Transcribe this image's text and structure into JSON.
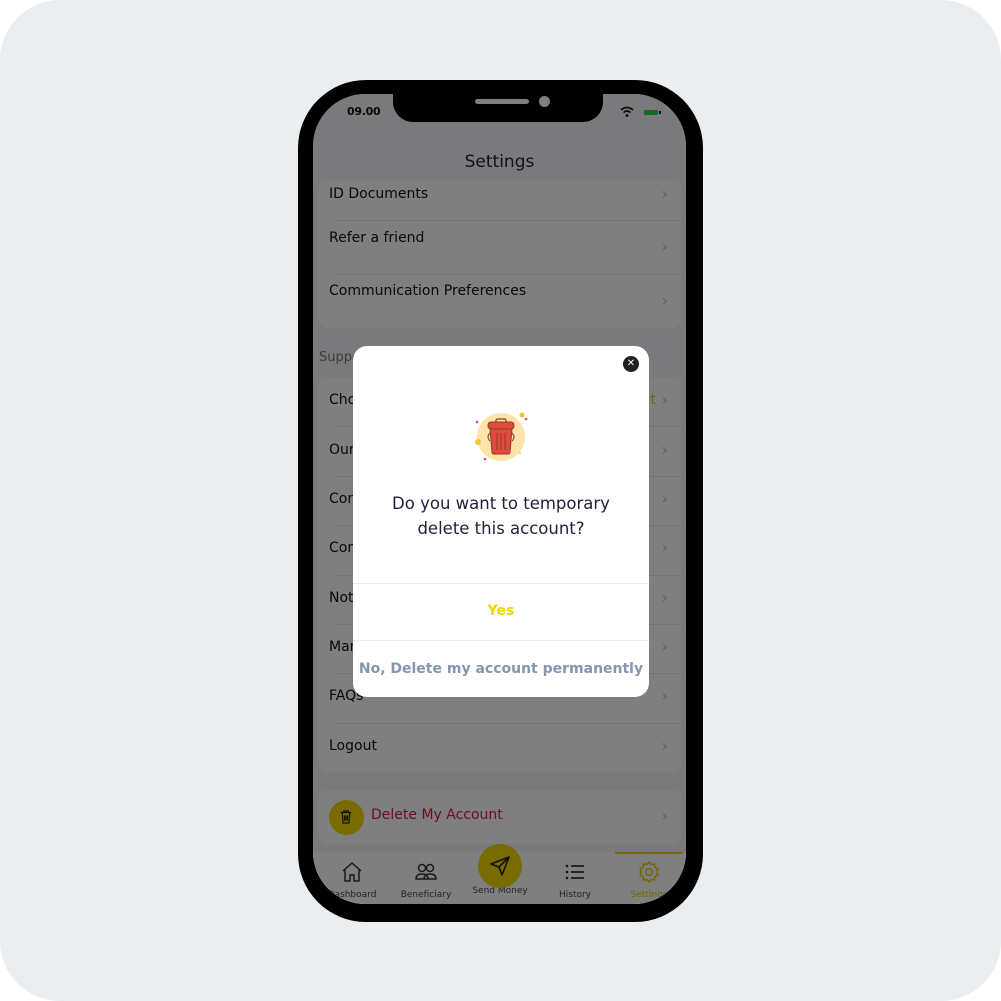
{
  "status_bar": {
    "time": "09.00",
    "wifi_icon": "wifi-icon",
    "battery_icon": "battery-icon"
  },
  "header": {
    "title": "Settings"
  },
  "account_section": {
    "items": [
      {
        "label": "ID Documents"
      },
      {
        "label": "Refer a friend"
      },
      {
        "label": "Communication Preferences"
      }
    ]
  },
  "support_section": {
    "label": "Support",
    "items": [
      {
        "label": "Cho",
        "extra": "it"
      },
      {
        "label": "Our"
      },
      {
        "label": "Con"
      },
      {
        "label": "Con"
      },
      {
        "label": "Not"
      },
      {
        "label": "Mar"
      },
      {
        "label": "FAQs"
      },
      {
        "label": "Logout"
      }
    ]
  },
  "delete_account": {
    "label": "Delete My Account",
    "icon": "trash-icon"
  },
  "tabbar": {
    "tabs": [
      {
        "label": "Dashboard",
        "icon": "home-icon"
      },
      {
        "label": "Beneficiary",
        "icon": "users-icon"
      },
      {
        "label": "Send Money",
        "icon": "send-icon"
      },
      {
        "label": "History",
        "icon": "list-icon"
      },
      {
        "label": "Settings",
        "icon": "gear-icon",
        "active": true
      }
    ]
  },
  "modal": {
    "close_icon": "close-icon",
    "illustration": "trash-can-illustration",
    "message": "Do you want to temporary delete this account?",
    "yes_label": "Yes",
    "no_label": "No, Delete my account permanently"
  },
  "colors": {
    "accent": "#f2d600",
    "danger": "#d81b3f",
    "secondary_button": "#8596ae",
    "title_text": "#261d3a"
  }
}
